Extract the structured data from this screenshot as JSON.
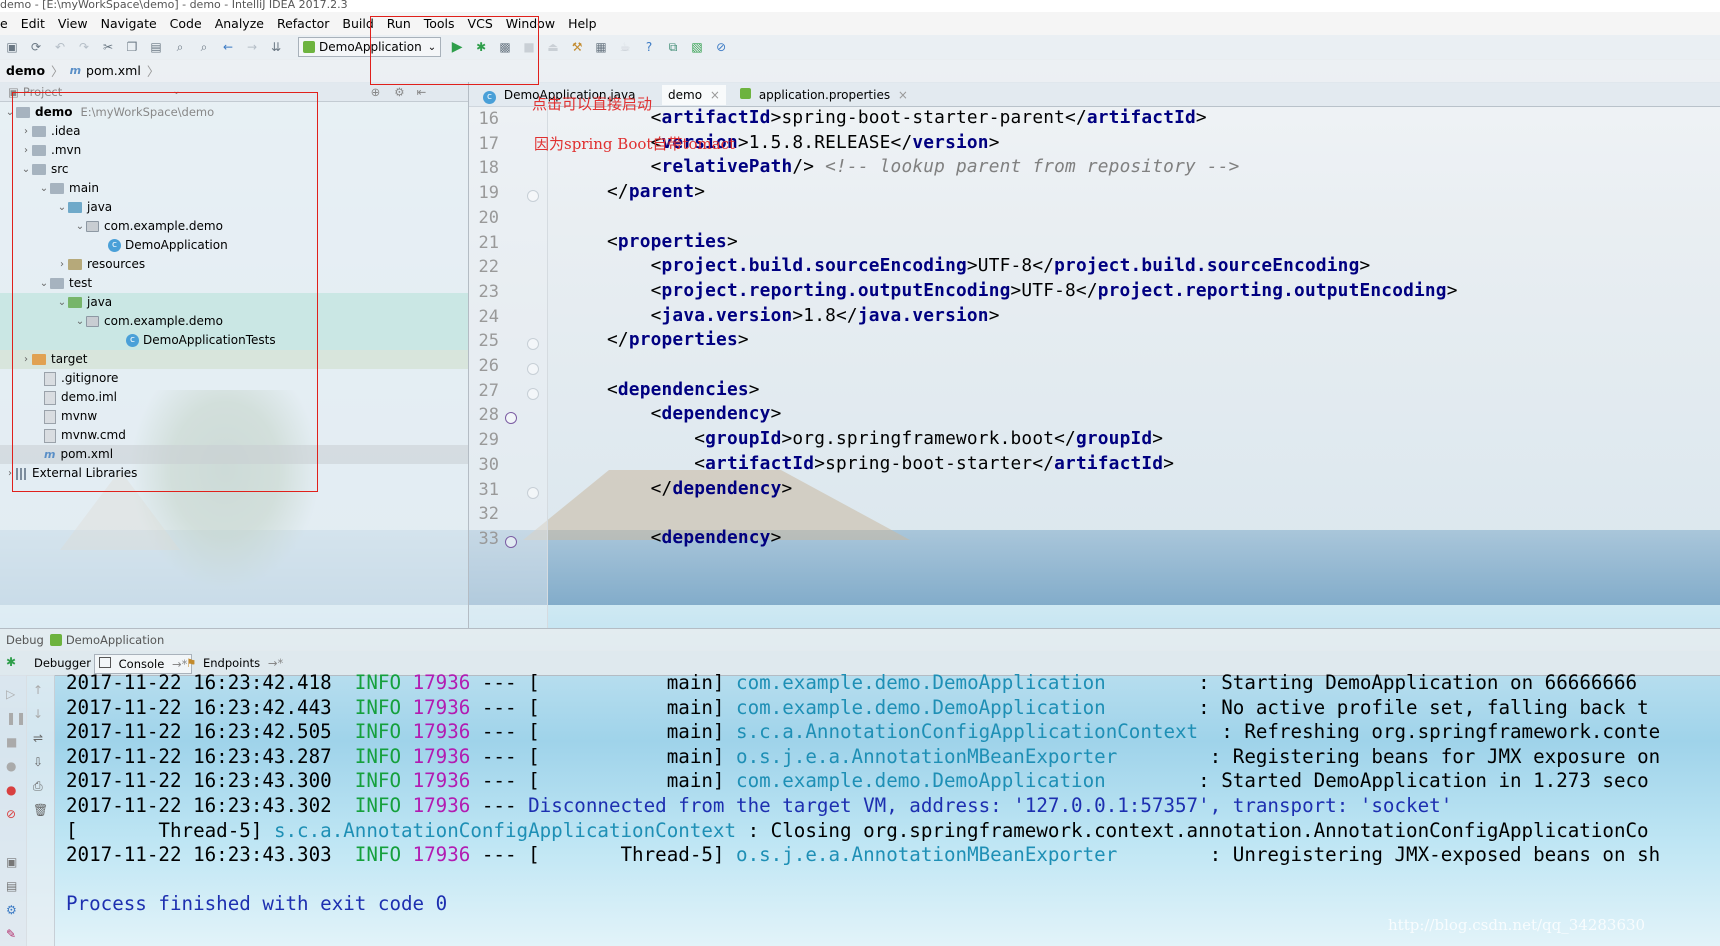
{
  "window": {
    "title": "demo - [E:\\myWorkSpace\\demo] - demo - IntelliJ IDEA 2017.2.3"
  },
  "menu": [
    "e",
    "Edit",
    "View",
    "Navigate",
    "Code",
    "Analyze",
    "Refactor",
    "Build",
    "Run",
    "Tools",
    "VCS",
    "Window",
    "Help"
  ],
  "toolbar": {
    "run_config": "DemoApplication"
  },
  "breadcrumb": {
    "project": "demo",
    "file": "pom.xml"
  },
  "project_panel": {
    "header": "Project",
    "root": {
      "name": "demo",
      "path": "E:\\myWorkSpace\\demo"
    },
    "items": [
      ".idea",
      ".mvn",
      "src",
      "main",
      "java",
      "com.example.demo",
      "DemoApplication",
      "resources",
      "test",
      "java",
      "com.example.demo",
      "DemoApplicationTests",
      "target",
      ".gitignore",
      "demo.iml",
      "mvnw",
      "mvnw.cmd",
      "pom.xml",
      "External Libraries"
    ]
  },
  "editor": {
    "tabs": [
      "DemoApplication.java",
      "demo",
      "application.properties"
    ],
    "annotations": [
      "点击可以直接启动",
      "因为spring Boot自带tomact"
    ],
    "line_numbers": [
      "16",
      "17",
      "18",
      "19",
      "20",
      "21",
      "22",
      "23",
      "24",
      "25",
      "26",
      "27",
      "28",
      "29",
      "30",
      "31",
      "32",
      "33"
    ],
    "lines": [
      {
        "pre": "    <",
        "tag": "artifactId",
        "mid": ">spring-boot-starter-parent</",
        "tag2": "artifactId",
        "post": ">"
      },
      {
        "pre": "    <",
        "tag": "version",
        "mid": ">1.5.8.RELEASE</",
        "tag2": "version",
        "post": ">"
      },
      {
        "pre": "    <",
        "tag": "relativePath",
        "mid": "/> ",
        "comment": "<!-- lookup parent from repository -->"
      },
      {
        "pre": "</",
        "tag": "parent",
        "post": ">"
      },
      {},
      {
        "pre": "<",
        "tag": "properties",
        "post": ">"
      },
      {
        "pre": "    <",
        "tag": "project.build.sourceEncoding",
        "mid": ">UTF-8</",
        "tag2": "project.build.sourceEncoding",
        "post": ">"
      },
      {
        "pre": "    <",
        "tag": "project.reporting.outputEncoding",
        "mid": ">UTF-8</",
        "tag2": "project.reporting.outputEncoding",
        "post": ">"
      },
      {
        "pre": "    <",
        "tag": "java.version",
        "mid": ">1.8</",
        "tag2": "java.version",
        "post": ">"
      },
      {
        "pre": "</",
        "tag": "properties",
        "post": ">"
      },
      {},
      {
        "pre": "<",
        "tag": "dependencies",
        "post": ">"
      },
      {
        "pre": "    <",
        "tag": "dependency",
        "post": ">"
      },
      {
        "pre": "        <",
        "tag": "groupId",
        "mid": ">org.springframework.boot</",
        "tag2": "groupId",
        "post": ">"
      },
      {
        "pre": "        <",
        "tag": "artifactId",
        "mid": ">spring-boot-starter</",
        "tag2": "artifactId",
        "post": ">"
      },
      {
        "pre": "    </",
        "tag": "dependency",
        "post": ">"
      },
      {},
      {
        "pre": "    <",
        "tag": "dependency",
        "post": ">"
      }
    ]
  },
  "debug": {
    "title": "Debug",
    "config": "DemoApplication",
    "tabs": [
      "Debugger",
      "Console",
      "Endpoints"
    ],
    "console": [
      {
        "ts": "2017-11-22 16:23:42.418",
        "level": "INFO",
        "pid": "17936",
        "sep": "--- [",
        "thread": "           main]",
        "logger": "com.example.demo.DemoApplication",
        "msg": "        : Starting DemoApplication on 66666666"
      },
      {
        "ts": "2017-11-22 16:23:42.443",
        "level": "INFO",
        "pid": "17936",
        "sep": "--- [",
        "thread": "           main]",
        "logger": "com.example.demo.DemoApplication",
        "msg": "        : No active profile set, falling back t"
      },
      {
        "ts": "2017-11-22 16:23:42.505",
        "level": "INFO",
        "pid": "17936",
        "sep": "--- [",
        "thread": "           main]",
        "logger": "s.c.a.AnnotationConfigApplicationContext",
        "msg": "  : Refreshing org.springframework.conte"
      },
      {
        "ts": "2017-11-22 16:23:43.287",
        "level": "INFO",
        "pid": "17936",
        "sep": "--- [",
        "thread": "           main]",
        "logger": "o.s.j.e.a.AnnotationMBeanExporter",
        "msg": "        : Registering beans for JMX exposure on"
      },
      {
        "ts": "2017-11-22 16:23:43.300",
        "level": "INFO",
        "pid": "17936",
        "sep": "--- [",
        "thread": "           main]",
        "logger": "com.example.demo.DemoApplication",
        "msg": "        : Started DemoApplication in 1.273 seco"
      },
      {
        "ts": "2017-11-22 16:23:43.302",
        "level": "INFO",
        "pid": "17936",
        "sep": "---",
        "blue": " Disconnected from the target VM, address: '127.0.0.1:57357', transport: 'socket'"
      },
      {
        "prefix": "[       Thread-5] ",
        "logger": "s.c.a.AnnotationConfigApplicationContext",
        "msg": " : Closing org.springframework.context.annotation.AnnotationConfigApplicationCo"
      },
      {
        "ts": "2017-11-22 16:23:43.303",
        "level": "INFO",
        "pid": "17936",
        "sep": "--- [",
        "thread": "       Thread-5]",
        "logger": "o.s.j.e.a.AnnotationMBeanExporter",
        "msg": "        : Unregistering JMX-exposed beans on sh"
      },
      {},
      {
        "blue": "Process finished with exit code 0"
      }
    ]
  },
  "watermark": "http://blog.csdn.net/qq_34283630",
  "colors": {
    "annotation_red": "#e0201b",
    "tag_blue": "#000080",
    "info_green": "#15a03c",
    "pid_magenta": "#b21bb1",
    "logger_cyan": "#1e8fb5"
  }
}
